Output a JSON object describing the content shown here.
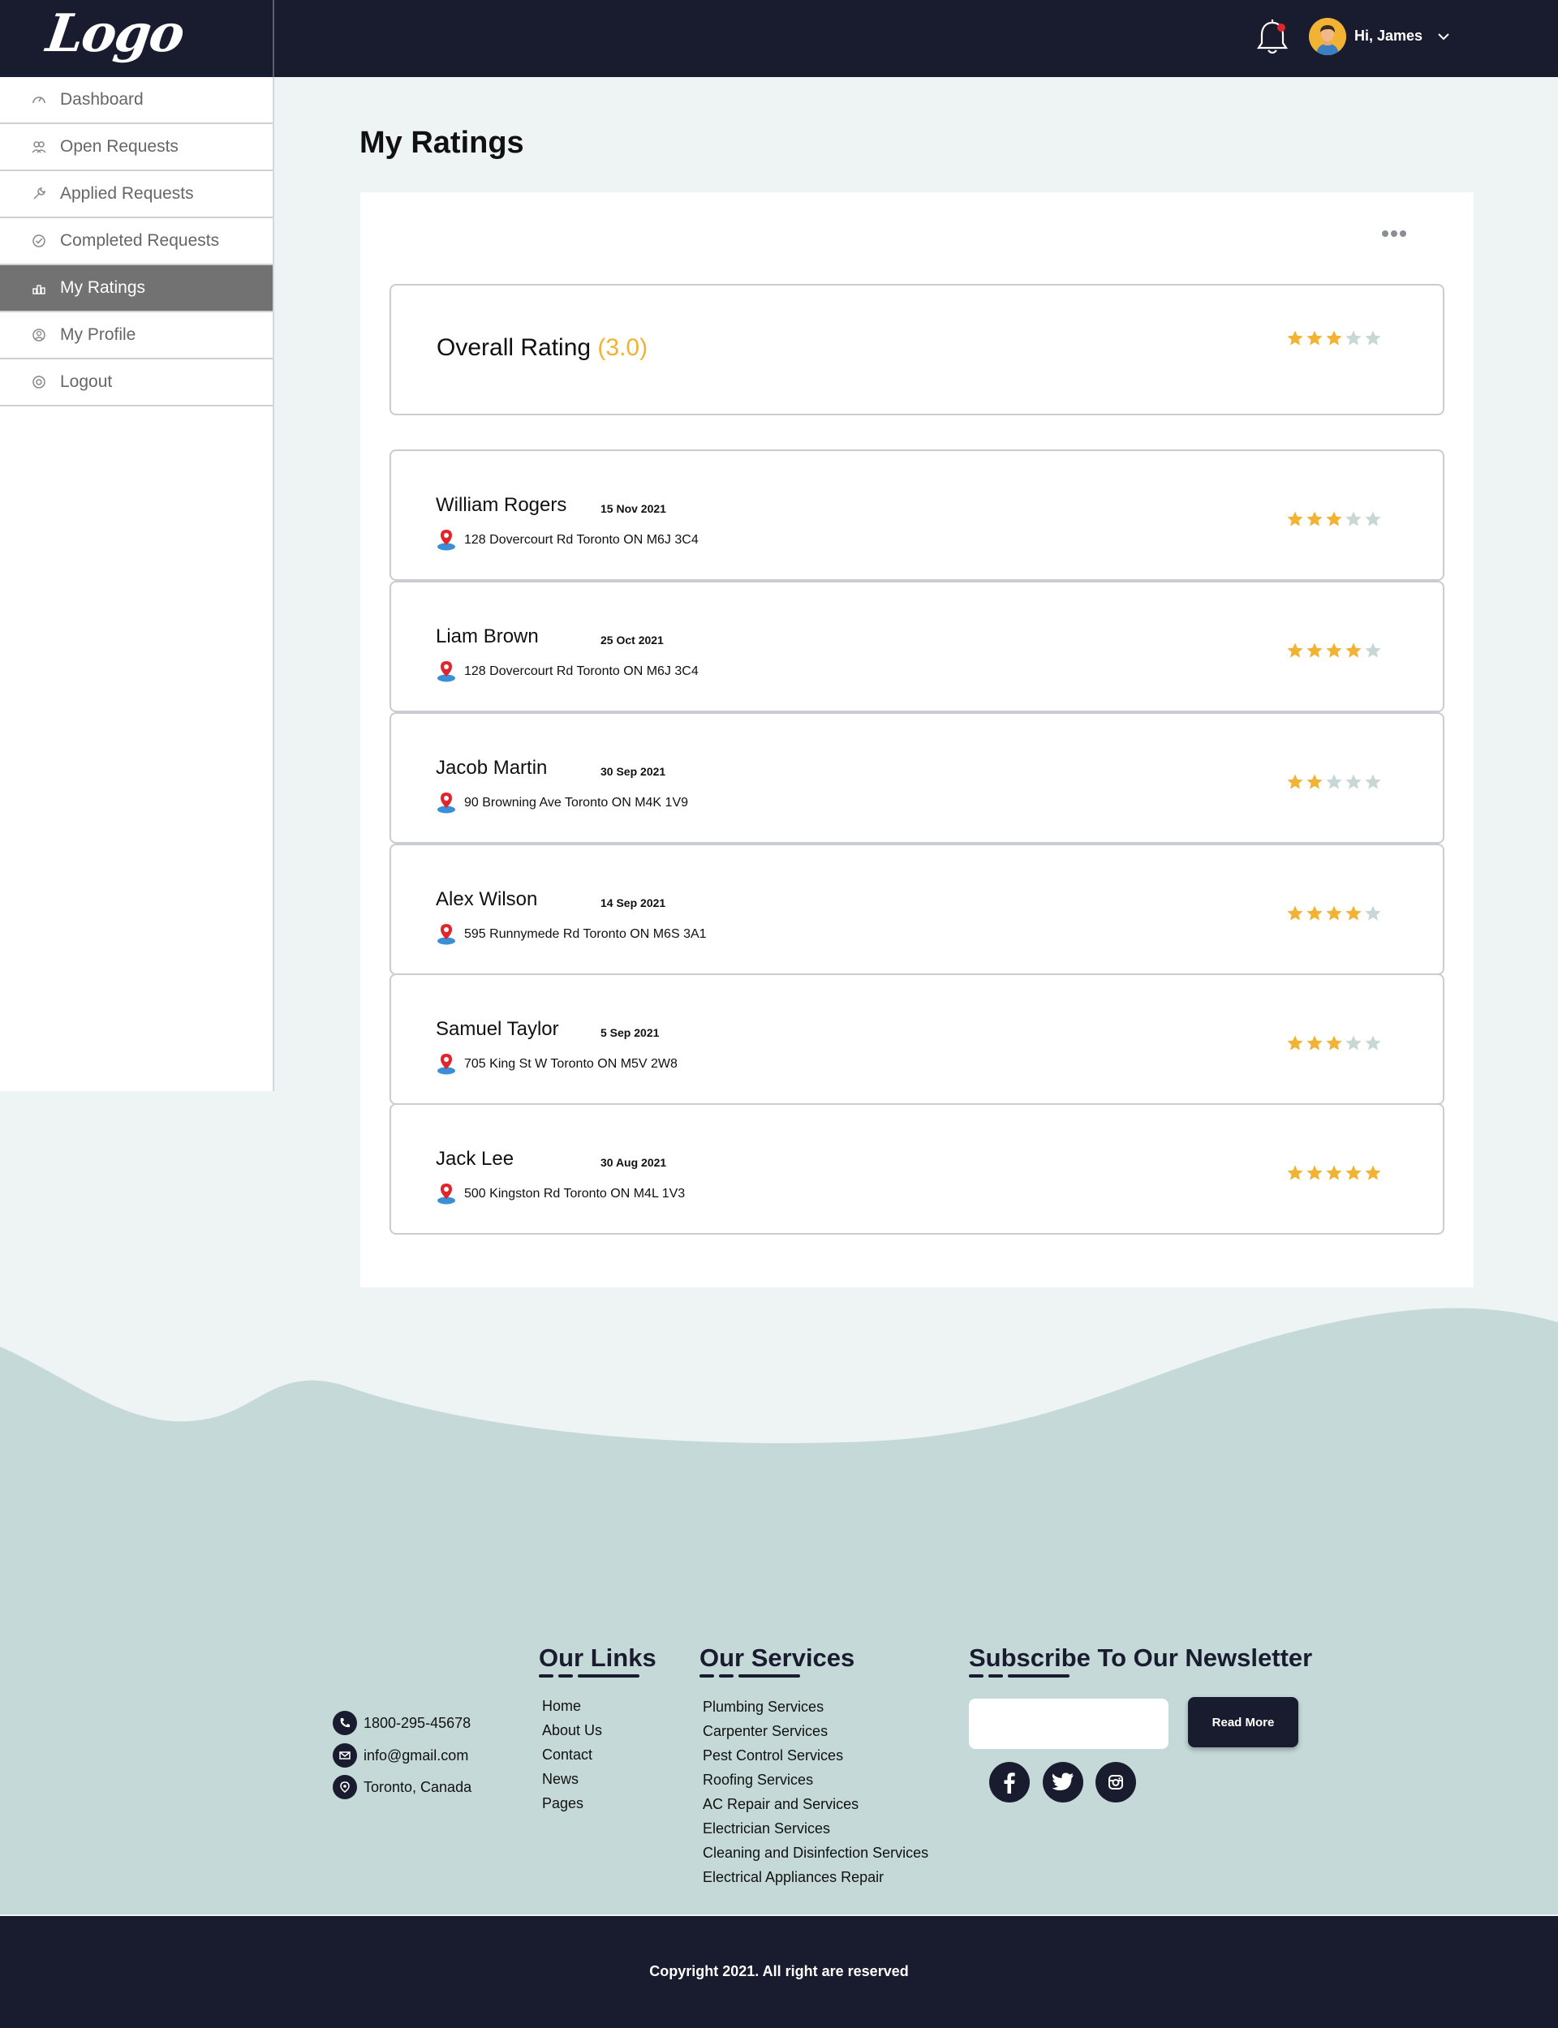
{
  "header": {
    "logo": "Logo",
    "greeting": "Hi, James",
    "icons": {
      "notification": "bell-icon",
      "avatar": "user-avatar",
      "menu": "chevron-down-icon"
    },
    "colors": {
      "bar": "#191b2e",
      "accent": "#f2b233",
      "notify_dot": "#e0262c"
    }
  },
  "sidebar": {
    "items": [
      {
        "label": "Dashboard",
        "icon": "gauge-icon",
        "active": false
      },
      {
        "label": "Open Requests",
        "icon": "users-icon",
        "active": false
      },
      {
        "label": "Applied Requests",
        "icon": "wrench-icon",
        "active": false
      },
      {
        "label": "Completed Requests",
        "icon": "check-circle-icon",
        "active": false
      },
      {
        "label": "My Ratings",
        "icon": "ratings-icon",
        "active": true
      },
      {
        "label": "My Profile",
        "icon": "profile-icon",
        "active": false
      },
      {
        "label": "Logout",
        "icon": "logout-icon",
        "active": false
      }
    ],
    "active_color": "#737273"
  },
  "main": {
    "title": "My Ratings",
    "more_icon": "more-dots-icon",
    "overall": {
      "label": "Overall Rating",
      "value": "(3.0)",
      "stars": 3,
      "max": 5
    },
    "reviews": [
      {
        "name": "William Rogers",
        "date": "15 Nov 2021",
        "address": "128 Dovercourt Rd Toronto ON M6J 3C4",
        "stars": 3
      },
      {
        "name": "Liam Brown",
        "date": "25 Oct 2021",
        "address": "128 Dovercourt Rd Toronto ON M6J 3C4",
        "stars": 4
      },
      {
        "name": "Jacob Martin",
        "date": "30 Sep 2021",
        "address": "90 Browning Ave Toronto ON M4K 1V9",
        "stars": 2
      },
      {
        "name": "Alex Wilson",
        "date": "14 Sep 2021",
        "address": "595 Runnymede Rd Toronto ON M6S 3A1",
        "stars": 4
      },
      {
        "name": "Samuel Taylor",
        "date": "5 Sep 2021",
        "address": "705 King St W Toronto ON M5V 2W8",
        "stars": 3
      },
      {
        "name": "Jack Lee",
        "date": "30 Aug 2021",
        "address": "500 Kingston Rd Toronto ON M4L 1V3",
        "stars": 5
      }
    ],
    "star_colors": {
      "filled": "#f2b233",
      "empty": "#c8d6d6"
    }
  },
  "footer": {
    "contact": [
      {
        "icon": "phone-icon",
        "text": "1800-295-45678"
      },
      {
        "icon": "mail-icon",
        "text": "info@gmail.com"
      },
      {
        "icon": "location-icon",
        "text": "Toronto, Canada"
      }
    ],
    "links_heading": "Our Links",
    "links": [
      "Home",
      "About Us",
      "Contact",
      "News",
      "Pages"
    ],
    "services_heading": "Our Services",
    "services": [
      "Plumbing Services",
      "Carpenter Services",
      "Pest Control Services",
      "Roofing Services",
      "AC Repair and Services",
      "Electrician Services",
      "Cleaning and Disinfection Services",
      "Electrical Appliances Repair"
    ],
    "newsletter_heading": "Subscribe To Our Newsletter",
    "newsletter_input": "",
    "newsletter_button": "Read More",
    "social": [
      "facebook-icon",
      "twitter-icon",
      "instagram-icon"
    ],
    "copyright": "Copyright 2021. All right are reserved",
    "colors": {
      "wave": "#c4d9d8",
      "bottom": "#191b2e"
    }
  }
}
